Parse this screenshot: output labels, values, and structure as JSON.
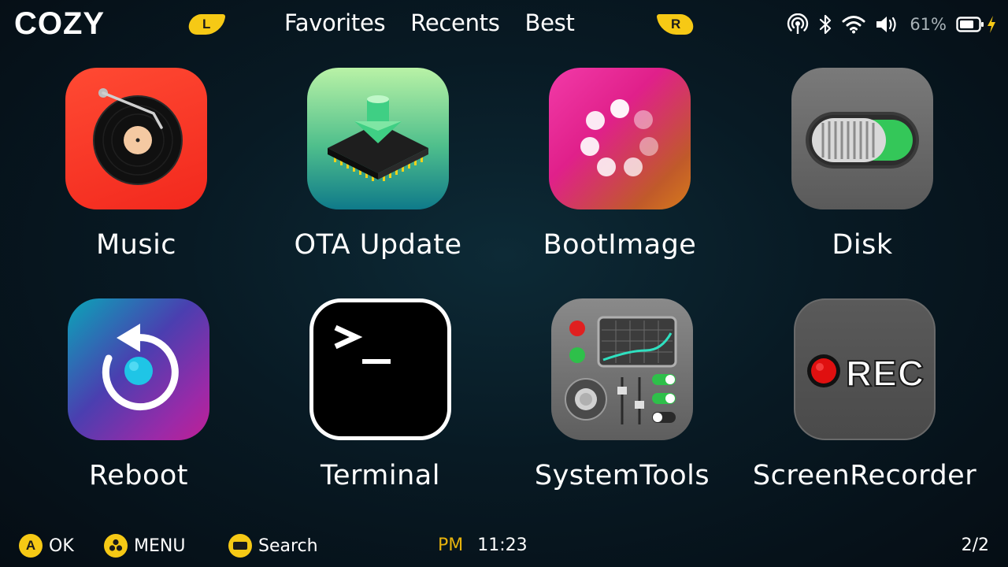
{
  "header": {
    "brand": "COZY",
    "left_shoulder": "L",
    "right_shoulder": "R",
    "tabs": [
      {
        "label": "Favorites"
      },
      {
        "label": "Recents"
      },
      {
        "label": "Best"
      }
    ]
  },
  "status": {
    "icons": [
      "hotspot-icon",
      "bluetooth-icon",
      "wifi-icon",
      "volume-icon",
      "battery-icon",
      "charging-icon"
    ],
    "battery_percent": "61%"
  },
  "apps": [
    {
      "label": "Music",
      "icon": "music-icon"
    },
    {
      "label": "OTA Update",
      "icon": "ota-update-icon"
    },
    {
      "label": "BootImage",
      "icon": "boot-image-icon"
    },
    {
      "label": "Disk",
      "icon": "disk-icon"
    },
    {
      "label": "Reboot",
      "icon": "reboot-icon"
    },
    {
      "label": "Terminal",
      "icon": "terminal-icon"
    },
    {
      "label": "SystemTools",
      "icon": "system-tools-icon"
    },
    {
      "label": "ScreenRecorder",
      "icon": "screen-recorder-icon",
      "rec_text": "REC"
    }
  ],
  "footer": {
    "ok": {
      "button": "A",
      "label": "OK"
    },
    "menu": {
      "label": "MENU"
    },
    "search": {
      "label": "Search"
    },
    "ampm": "PM",
    "time": "11:23",
    "page": "2/2"
  },
  "colors": {
    "accent": "#f6c915",
    "ampm": "#e6b20c",
    "background": "#081a24"
  }
}
